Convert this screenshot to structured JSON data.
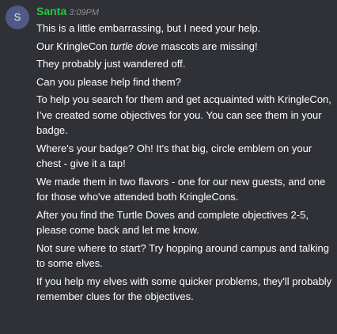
{
  "author": "Santa",
  "avatar_letter": "S",
  "timestamp": "3:09PM",
  "messages": [
    "This is a little embarrassing, but I need your help.",
    {
      "before": "Our KringleCon ",
      "emphasis": "turtle dove",
      "after": " mascots are missing!"
    },
    "They probably just wandered off.",
    "Can you please help find them?",
    "To help you search for them and get acquainted with KringleCon, I’ve created some objectives for you. You can see them in your badge.",
    "Where's your badge? Oh! It's that big, circle emblem on your chest - give it a tap!",
    "We made them in two flavors - one for our new guests, and one for those who've attended both KringleCons.",
    "After you find the Turtle Doves and complete objectives 2-5, please come back and let me know.",
    "Not sure where to start? Try hopping around campus and talking to some elves.",
    "If you help my elves with some quicker problems, they'll probably remember clues for the objectives."
  ],
  "colors": {
    "background": "#303136",
    "author": "#23c742",
    "timestamp": "#8d8d8f",
    "text": "#ffffff",
    "avatar": "#505a86"
  }
}
